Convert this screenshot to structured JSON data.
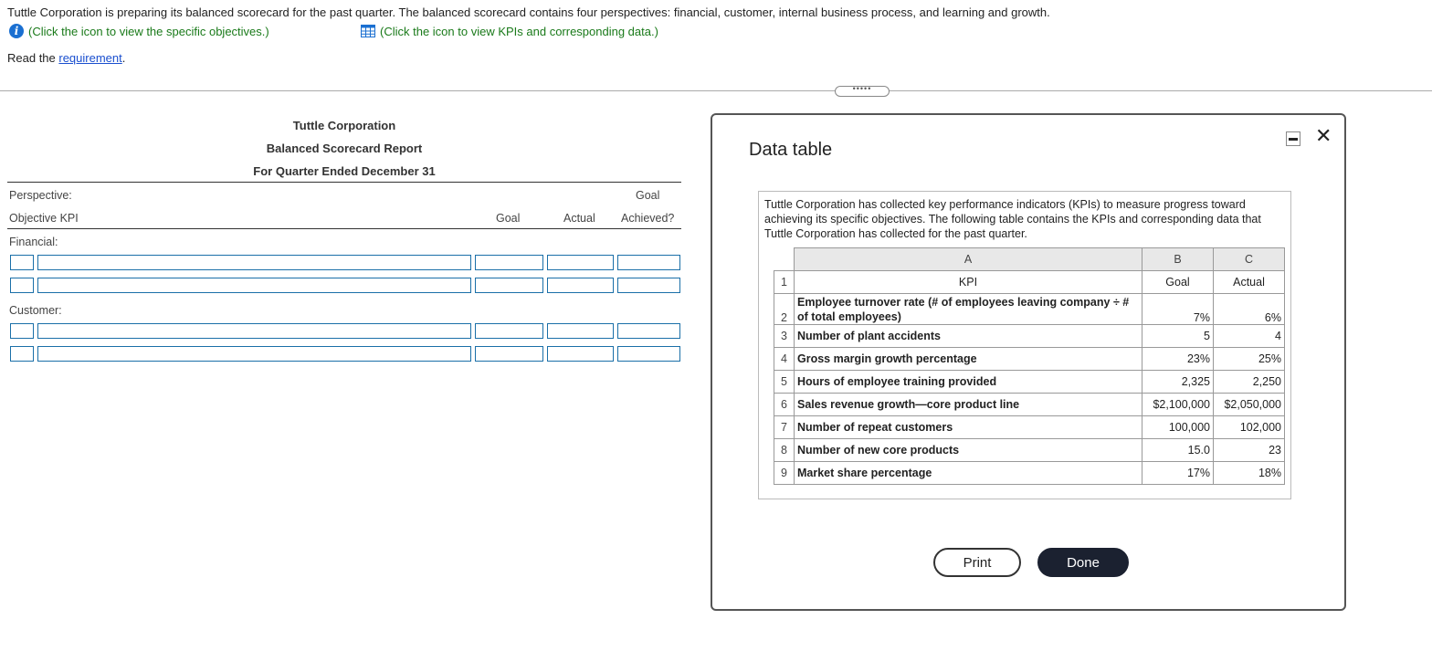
{
  "intro_text": "Tuttle Corporation is preparing its balanced scorecard for the past quarter. The balanced scorecard contains four perspectives: financial, customer, internal business process, and learning and growth.",
  "hint_objectives": "(Click the icon to view the specific objectives.)",
  "hint_kpis": "(Click the icon to view KPIs and corresponding data.)",
  "read_prefix": "Read the ",
  "read_link": "requirement",
  "read_suffix": ".",
  "splitter": "•••••",
  "report": {
    "company": "Tuttle Corporation",
    "title": "Balanced Scorecard Report",
    "period": "For Quarter Ended December 31",
    "perspective_label": "Perspective:",
    "objective_kpi_label": "Objective KPI",
    "goal_label": "Goal",
    "actual_label": "Actual",
    "goal_achieved_line1": "Goal",
    "goal_achieved_line2": "Achieved?",
    "financial_label": "Financial:",
    "customer_label": "Customer:"
  },
  "dialog": {
    "title": "Data table",
    "description": "Tuttle Corporation has collected key performance indicators (KPIs) to measure progress toward achieving its specific objectives. The following table contains the KPIs and corresponding data that Tuttle Corporation has collected for the past quarter.",
    "col_a": "A",
    "col_b": "B",
    "col_c": "C",
    "header_row": {
      "n": "1",
      "kpi": "KPI",
      "goal": "Goal",
      "actual": "Actual"
    },
    "rows": [
      {
        "n": "2",
        "kpi": "Employee turnover rate (# of employees leaving company ÷ # of total employees)",
        "goal": "7%",
        "actual": "6%"
      },
      {
        "n": "3",
        "kpi": "Number of plant accidents",
        "goal": "5",
        "actual": "4"
      },
      {
        "n": "4",
        "kpi": "Gross margin growth percentage",
        "goal": "23%",
        "actual": "25%"
      },
      {
        "n": "5",
        "kpi": "Hours of employee training provided",
        "goal": "2,325",
        "actual": "2,250"
      },
      {
        "n": "6",
        "kpi": "Sales revenue growth—core product line",
        "goal": "$2,100,000",
        "actual": "$2,050,000"
      },
      {
        "n": "7",
        "kpi": "Number of repeat customers",
        "goal": "100,000",
        "actual": "102,000"
      },
      {
        "n": "8",
        "kpi": "Number of new core products",
        "goal": "15.0",
        "actual": "23"
      },
      {
        "n": "9",
        "kpi": "Market share percentage",
        "goal": "17%",
        "actual": "18%"
      }
    ],
    "print_label": "Print",
    "done_label": "Done"
  }
}
